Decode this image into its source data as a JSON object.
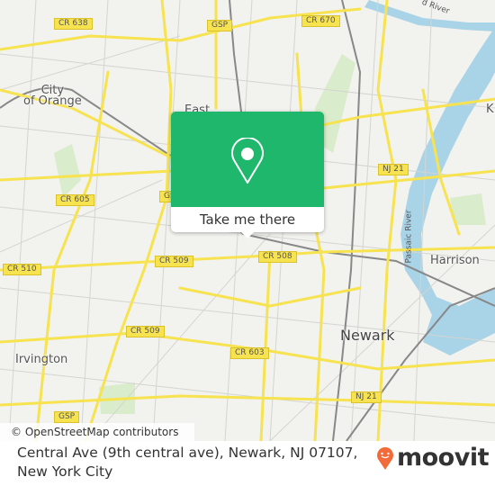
{
  "map": {
    "shields": {
      "cr638": "CR 638",
      "gsp_top": "GSP",
      "cr670": "CR 670",
      "cr605": "CR 605",
      "gsp_mid": "GS",
      "nj21_top": "NJ 21",
      "cr510": "CR 510",
      "cr509_a": "CR 509",
      "cr508": "CR 508",
      "cr509_b": "CR 509",
      "cr603": "CR 603",
      "nj21_bottom": "NJ 21",
      "gsp_bottom": "GSP"
    },
    "places": {
      "city_of_orange": "City\nof Orange",
      "east": "East",
      "harrison": "Harrison",
      "newark": "Newark",
      "irvington": "Irvington",
      "k": "K"
    },
    "water": {
      "river_top": "d River",
      "passaic": "Passaic River"
    },
    "colors": {
      "land": "#f2f2ef",
      "road": "#f7e34f",
      "water": "#a9d3e6",
      "park": "#d9eccb"
    }
  },
  "attribution": "© OpenStreetMap contributors",
  "popup": {
    "button_label": "Take me there",
    "color": "#1fb76b",
    "icon": "map-pin-icon"
  },
  "footer": {
    "address": "Central Ave (9th central ave), Newark, NJ 07107, New York City",
    "brand": "moovit",
    "brand_color": "#f26b3a"
  }
}
